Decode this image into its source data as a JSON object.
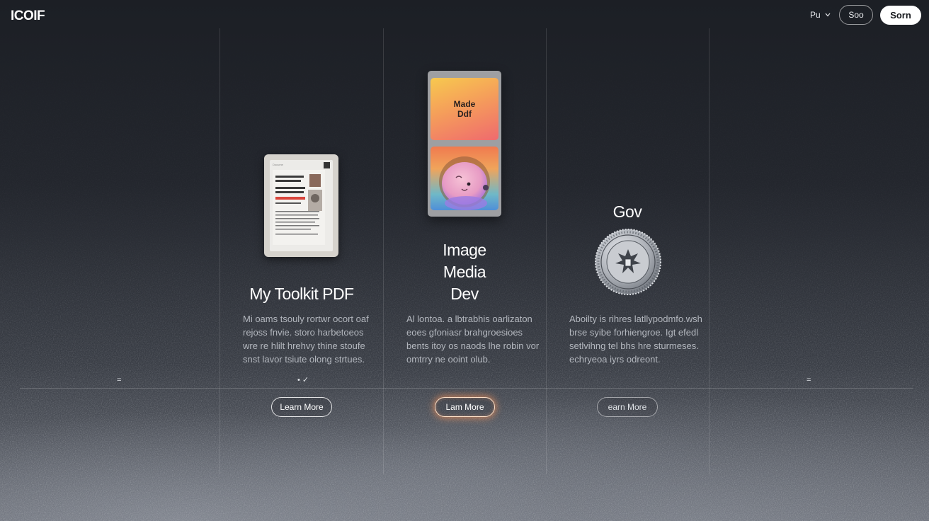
{
  "header": {
    "logo": "ICOIF",
    "language": "Pu",
    "signin_label": "Soo",
    "signup_label": "Sorn"
  },
  "columns": [
    {
      "id": "pdf",
      "title": "My Toolkit PDF",
      "description": "Mi oams tsouly rortwr ocort oaf\nrejoss fnvie. storo harbetoeos\nwre re hlilt hrehvy thine stoufe\nsnst lavor tsiute olong strtues.",
      "button": "Learn More",
      "mockup_text": {
        "header": "Docume",
        "lines": [
          "AKOMHE",
          "FLOBINESS",
          "ROOLE MODHS",
          "HLN BROMS",
          "PACHOMES"
        ]
      }
    },
    {
      "id": "image",
      "title_lines": [
        "Image",
        "Media",
        "Dev"
      ],
      "description": "Al lontoa. a lbtrabhis oarlizaton\neoes gfoniasr brahgroesioes\nbents itoy os naods lhe robin vor\nomtrry ne ooint olub.",
      "button": "Lam More",
      "phone_card_title": "Made\nDdf"
    },
    {
      "id": "gov",
      "title": "Gov",
      "description": "Aboilty is rihres latllypodmfo.wsh\nbrse syibe forhiengroe. Igt efedl\nsetlvihng tel bhs hre sturmeses.\nechryeoa iyrs odreont.",
      "button": "earn More"
    }
  ],
  "markers": {
    "left": "=",
    "center": "• ✓",
    "right": "="
  },
  "icons": {
    "chevron": "chevron-down-icon",
    "seal": "gov-seal-icon"
  },
  "colors": {
    "accent_glow": "#ff965a",
    "button_primary_bg": "#ffffff"
  }
}
